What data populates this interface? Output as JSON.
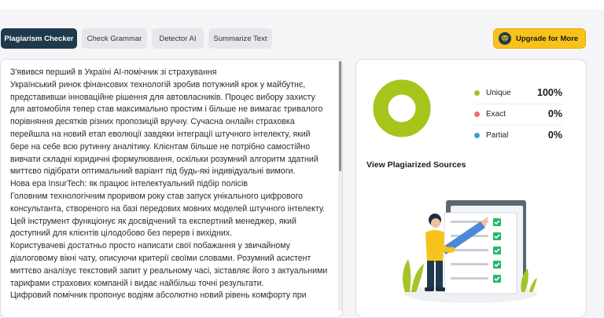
{
  "tabs": [
    {
      "label": "Plagiarism Checker",
      "active": true
    },
    {
      "label": "Check Grammar",
      "active": false
    },
    {
      "label": "Detector AI",
      "active": false
    },
    {
      "label": "Summarize Text",
      "active": false
    }
  ],
  "upgrade": {
    "label": "Upgrade for More",
    "icon": "diamond-icon"
  },
  "editor": {
    "paragraphs": [
      "З'явився перший в Україні AI-помічник зі страхування",
      "Український ринок фінансових технологій зробив потужний крок у майбутнє, представивши інноваційне рішення для автовласників. Процес вибору захисту для автомобіля тепер став максимально простим і більше не вимагає тривалого порівняння десятків різних пропозицій вручну. Сучасна онлайн страховка перейшла на новий етап еволюції завдяки інтеграції штучного інтелекту, який бере на себе всю рутинну аналітику. Клієнтам більше не потрібно самостійно вивчати складні юридичні формулювання, оскільки розумний алгоритм здатний миттєво підібрати оптимальний варіант під будь-які індивідуальні вимоги.",
      "Нова ера InsurTech: як працює інтелектуальний підбір полісів",
      "Головним технологічним проривом року став запуск унікального цифрового консультанта, створеного на базі передових мовних моделей штучного інтелекту. Цей інструмент функціонує як досвідчений та експертний менеджер, який доступний для клієнтів цілодобово без перерв і вихідних.",
      "Користувачеві достатньо просто написати свої побажання у звичайному діалоговому вікні чату, описуючи критерії своїми словами. Розумний асистент миттєво аналізує текстовий запит у реальному часі, зіставляє його з актуальними тарифами страхових компаній і видає найбільш точні результати.",
      "Цифровий помічник пропонує водіям абсолютно новий рівень комфорту при"
    ]
  },
  "results": {
    "legend": [
      {
        "label": "Unique",
        "value": "100%",
        "color": "#a6c51b"
      },
      {
        "label": "Exact",
        "value": "0%",
        "color": "#f06b6b"
      },
      {
        "label": "Partial",
        "value": "0%",
        "color": "#3aa0d5"
      }
    ],
    "unique_fraction": 1.0,
    "donut_color": "#a6c51b",
    "view_sources_label": "View Plagiarized Sources"
  }
}
